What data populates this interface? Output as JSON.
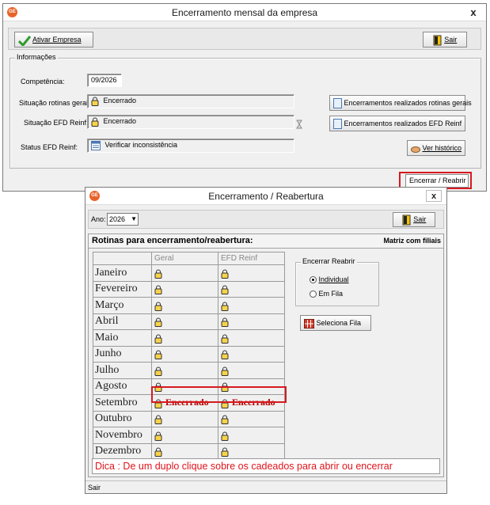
{
  "main_window": {
    "title": "Encerramento mensal da empresa",
    "close_label": "x",
    "toolbar": {
      "activate_label": "Ativar Empresa",
      "activate_mnemonic": "A",
      "exit_label": "Sair",
      "exit_mnemonic": "S"
    },
    "info_group": {
      "legend": "Informações",
      "competencia_label": "Competência:",
      "competencia_value": "09/2026",
      "situacao_gerais_label": "Situação rotinas gerais:",
      "situacao_gerais_value": "Encerrado",
      "situacao_reinf_label": "Situação EFD Reinf:",
      "situacao_reinf_value": "Encerrado",
      "status_reinf_label": "Status EFD Reinf:",
      "status_reinf_value": "Verificar inconsistência",
      "btn_gerais": "Encerramentos realizados rotinas gerais",
      "btn_reinf": "Encerramentos realizados EFD Reinf",
      "btn_historico": "Ver histórico"
    },
    "encerrar_reabrir_label": "Encerrar / Reabrir"
  },
  "dialog": {
    "title": "Encerramento / Reabertura",
    "close_label": "x",
    "year_label": "Ano:",
    "year_value": "2026",
    "exit_label": "Sair",
    "section_title": "Rotinas para encerramento/reabertura:",
    "matrix_label": "Matriz com filiais",
    "columns": [
      "Geral",
      "EFD Reinf"
    ],
    "months": [
      {
        "name": "Janeiro",
        "geral": "",
        "reinf": ""
      },
      {
        "name": "Fevereiro",
        "geral": "",
        "reinf": ""
      },
      {
        "name": "Março",
        "geral": "",
        "reinf": ""
      },
      {
        "name": "Abril",
        "geral": "",
        "reinf": ""
      },
      {
        "name": "Maio",
        "geral": "",
        "reinf": ""
      },
      {
        "name": "Junho",
        "geral": "",
        "reinf": ""
      },
      {
        "name": "Julho",
        "geral": "",
        "reinf": ""
      },
      {
        "name": "Agosto",
        "geral": "",
        "reinf": ""
      },
      {
        "name": "Setembro",
        "geral": "Encerrado",
        "reinf": "Encerrado"
      },
      {
        "name": "Outubro",
        "geral": "",
        "reinf": ""
      },
      {
        "name": "Novembro",
        "geral": "",
        "reinf": ""
      },
      {
        "name": "Dezembro",
        "geral": "",
        "reinf": ""
      }
    ],
    "reopen_group": {
      "legend": "Encerrar Reabrir",
      "option_individual": "Individual",
      "option_fila": "Em Fila",
      "selected": "Individual"
    },
    "select_queue_label": "Seleciona Fila",
    "tip": "Dica : De um duplo clique sobre os cadeados para  abrir ou encerrar",
    "status_bar": "Sair"
  },
  "colors": {
    "highlight_red": "#d7191f",
    "tip_red": "#e0141b",
    "closed_text": "#b00000"
  }
}
